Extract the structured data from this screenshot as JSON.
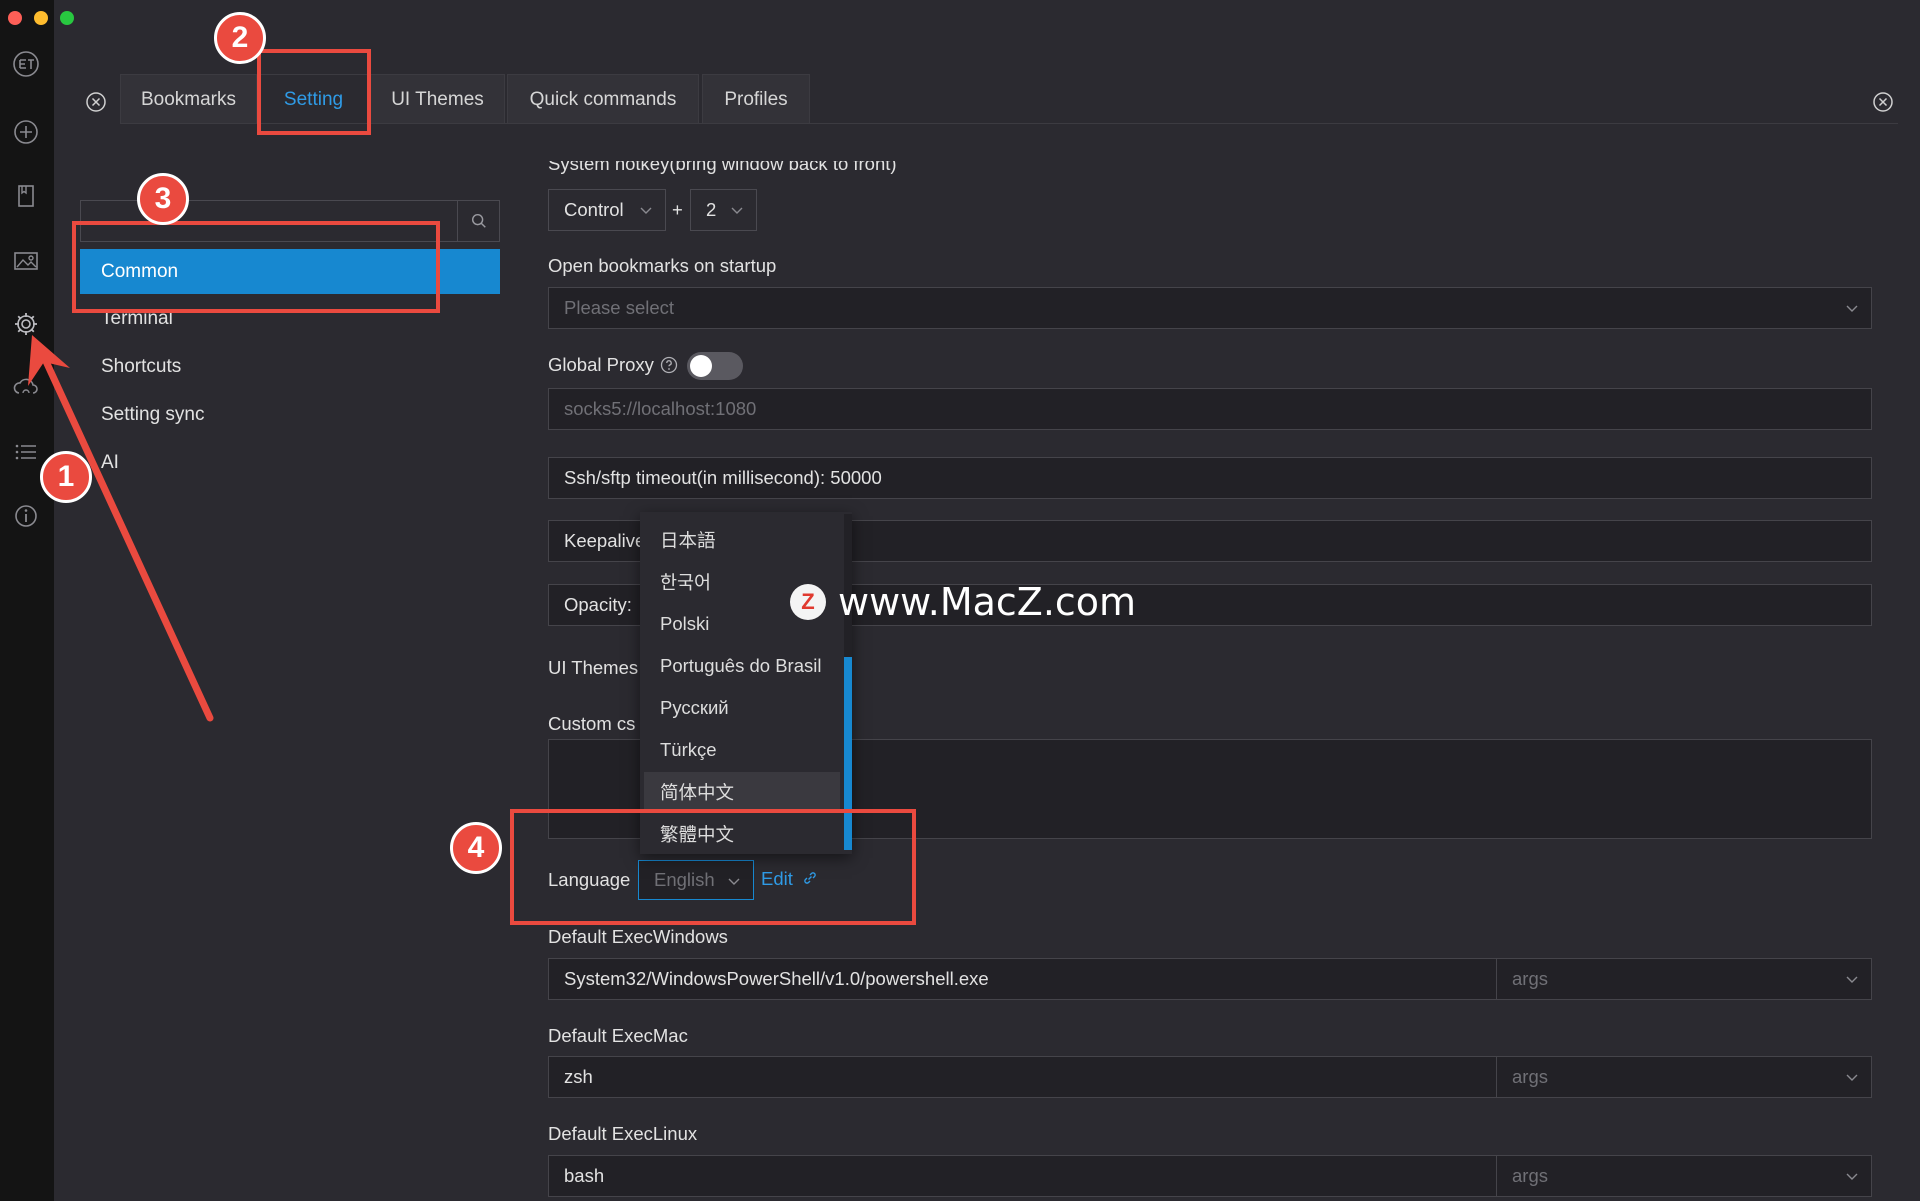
{
  "tabs": [
    {
      "label": "Bookmarks"
    },
    {
      "label": "Setting"
    },
    {
      "label": "UI Themes"
    },
    {
      "label": "Quick commands"
    },
    {
      "label": "Profiles"
    }
  ],
  "sidebar": {
    "items": [
      {
        "label": "Common"
      },
      {
        "label": "Terminal"
      },
      {
        "label": "Shortcuts"
      },
      {
        "label": "Setting sync"
      },
      {
        "label": "AI"
      }
    ]
  },
  "settings": {
    "hotkey_label": "System hotkey(bring window back to front)",
    "hotkey_modifier": "Control",
    "hotkey_plus": "+",
    "hotkey_key": "2",
    "open_bookmarks_label": "Open bookmarks on startup",
    "open_bookmarks_placeholder": "Please select",
    "global_proxy_label": "Global Proxy",
    "proxy_placeholder": "socks5://localhost:1080",
    "ssh_timeout": "Ssh/sftp timeout(in millisecond): 50000",
    "keepalive_label": "Keepalive",
    "opacity_label": "Opacity:",
    "ui_themes_label": "UI Themes",
    "custom_css_label": "Custom cs",
    "language_label": "Language",
    "language_value": "English",
    "edit_link": "Edit",
    "default_exec_windows_label": "Default ExecWindows",
    "default_exec_windows_value": "System32/WindowsPowerShell/v1.0/powershell.exe",
    "default_exec_mac_label": "Default ExecMac",
    "default_exec_mac_value": "zsh",
    "default_exec_linux_label": "Default ExecLinux",
    "default_exec_linux_value": "bash",
    "args_placeholder": "args"
  },
  "language_options": [
    "日本語",
    "한국어",
    "Polski",
    "Português do Brasil",
    "Русский",
    "Türkçe",
    "简体中文",
    "繁體中文"
  ],
  "annotations": [
    "1",
    "2",
    "3",
    "4"
  ],
  "watermark": {
    "logo": "Z",
    "text": "www.MacZ.com"
  },
  "colors": {
    "accent": "#1788d0",
    "link": "#2f9be6",
    "annotation_red": "#ea4a3f",
    "background": "#2b2a30",
    "rail": "#141414"
  }
}
